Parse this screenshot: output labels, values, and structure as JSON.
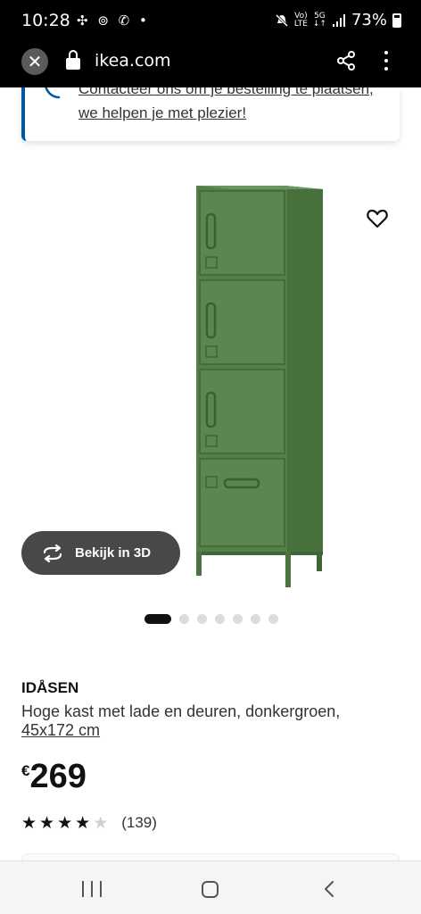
{
  "status_bar": {
    "time": "10:28",
    "left_icons": "✣ ⊚ ✆ •",
    "volte_top": "Vo)",
    "volte_bottom": "LTE",
    "net_top": "5G",
    "net_bottom": "↓↑",
    "battery_percent": "73%"
  },
  "browser": {
    "close_glyph": "✕",
    "url": "ikea.com",
    "icons": [
      "close-icon",
      "lock-icon",
      "share-icon",
      "more-icon"
    ]
  },
  "contact_banner": {
    "text": "Contacteer ons om je bestelling te plaatsen, we helpen je met plezier!",
    "accent_color": "#0058a3"
  },
  "gallery": {
    "view_3d_label": "Bekijk in 3D",
    "total_images": 7,
    "active_index": 0,
    "product_color": "#4f7f44"
  },
  "product": {
    "name": "IDÅSEN",
    "description": "Hoge kast met lade en deuren, donkergroen,",
    "size": "45x172 cm",
    "currency": "€",
    "price": "269",
    "rating": 4,
    "rating_max": 5,
    "reviews": "(139)"
  }
}
